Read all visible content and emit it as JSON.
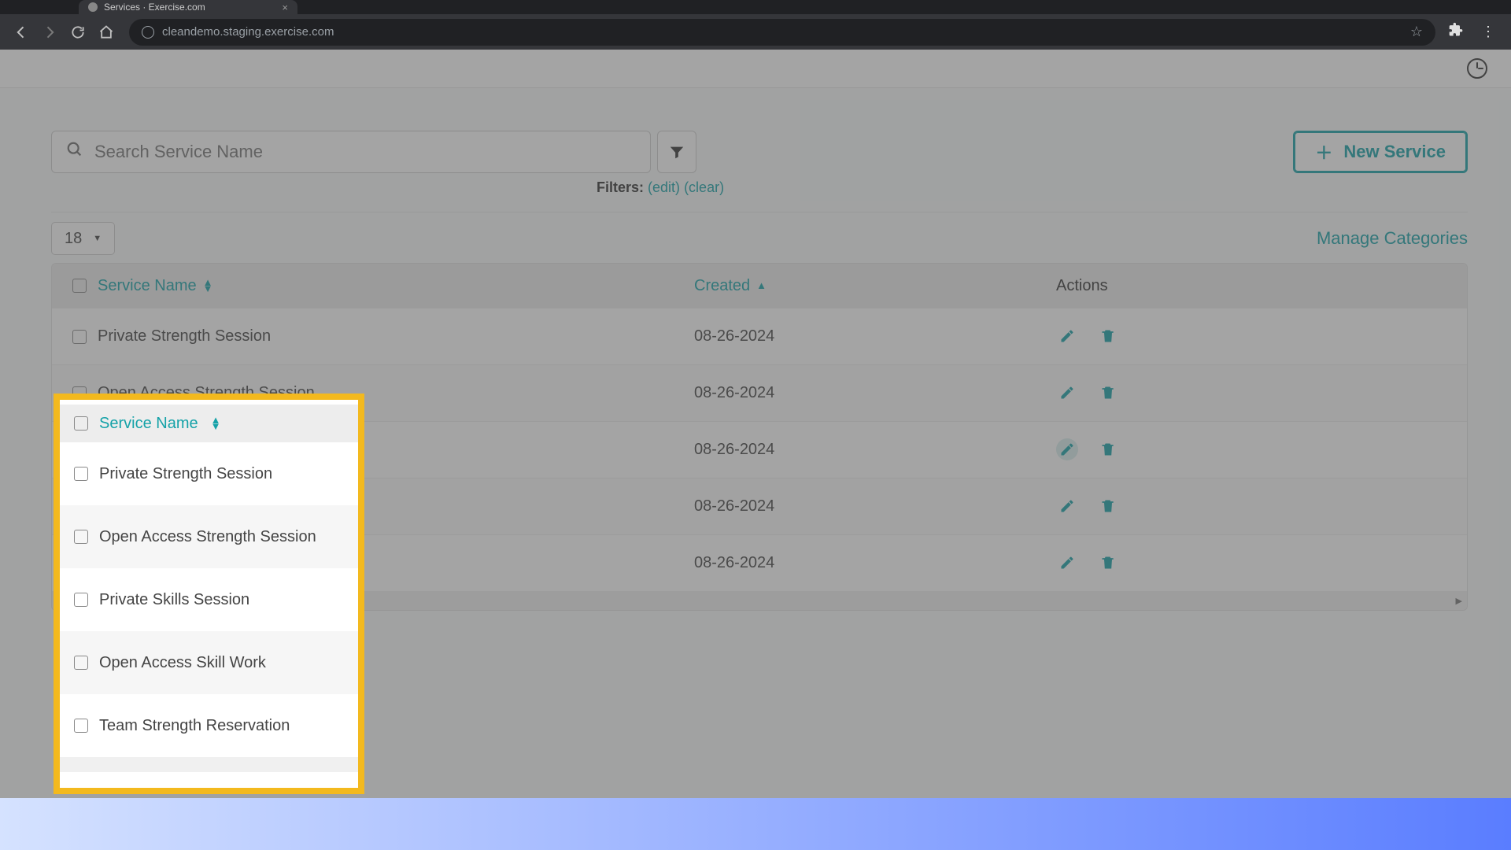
{
  "browser": {
    "tab_title": "Services · Exercise.com",
    "url": "cleandemo.staging.exercise.com"
  },
  "header": {
    "search_placeholder": "Search Service Name",
    "new_button": "New Service",
    "filters_label": "Filters:",
    "edit_link": "(edit)",
    "clear_link": "(clear)",
    "page_size": "18",
    "manage_categories": "Manage Categories"
  },
  "table": {
    "col_name": "Service Name",
    "col_created": "Created",
    "col_actions": "Actions",
    "rows": [
      {
        "name": "Private Strength Session",
        "created": "08-26-2024"
      },
      {
        "name": "Open Access Strength Session",
        "created": "08-26-2024"
      },
      {
        "name": "Private Skills Session",
        "created": "08-26-2024"
      },
      {
        "name": "Open Access Skill Work",
        "created": "08-26-2024"
      },
      {
        "name": "Team Strength Reservation",
        "created": "08-26-2024"
      }
    ]
  },
  "colors": {
    "accent": "#15a2a8",
    "highlight": "#f3b91e"
  }
}
